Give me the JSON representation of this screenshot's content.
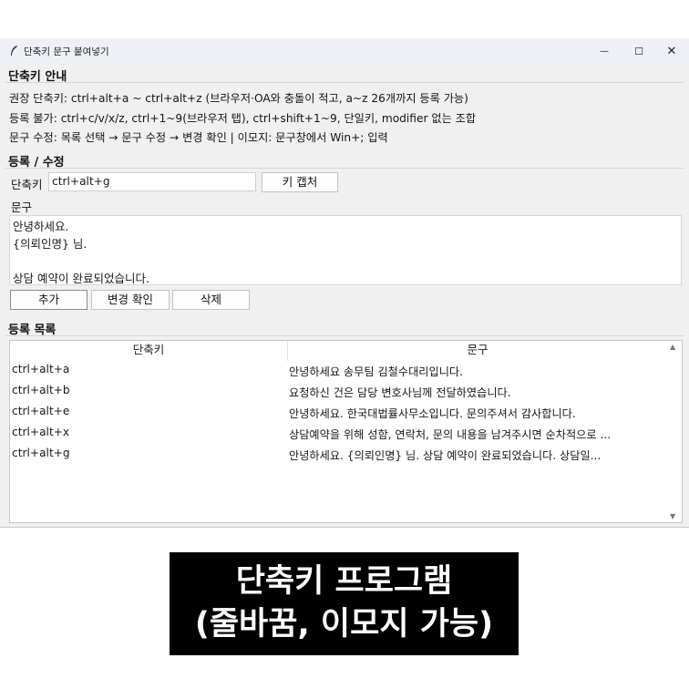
{
  "window": {
    "title": "단축키 문구 붙여넣기",
    "controls": {
      "minimize": "—",
      "maximize": "☐",
      "close": "✕"
    }
  },
  "guide": {
    "header": "단축키 안내",
    "lines": [
      "권장 단축키: ctrl+alt+a ~ ctrl+alt+z  (브라우저·OA와 충돌이 적고, a~z 26개까지 등록 가능)",
      "등록 불가: ctrl+c/v/x/z, ctrl+1~9(브라우저 탭), ctrl+shift+1~9, 단일키, modifier 없는 조합",
      "문구 수정: 목록 선택 → 문구 수정 → 변경 확인  |  이모지: 문구창에서 Win+; 입력"
    ]
  },
  "edit": {
    "header": "등록 / 수정",
    "hotkey_label": "단축키",
    "hotkey_value": "ctrl+alt+g",
    "capture_button": "키 캡처",
    "phrase_label": "문구",
    "phrase_lines": [
      "안녕하세요.",
      "{의뢰인명} 님.",
      "",
      "상담 예약이 완료되었습니다."
    ],
    "buttons": {
      "add": "추가",
      "confirm": "변경 확인",
      "delete": "삭제"
    }
  },
  "list": {
    "header": "등록 목록",
    "columns": [
      "단축키",
      "문구"
    ],
    "rows": [
      {
        "hotkey": "ctrl+alt+a",
        "phrase": "안녕하세요 송무팀 김철수대리입니다."
      },
      {
        "hotkey": "ctrl+alt+b",
        "phrase": "요청하신 건은 담당 변호사님께 전달하였습니다."
      },
      {
        "hotkey": "ctrl+alt+e",
        "phrase": "안녕하세요. 한국대법률사무소입니다. 문의주셔서 감사합니다."
      },
      {
        "hotkey": "ctrl+alt+x",
        "phrase": "상담예약을 위해 성함, 연락처, 문의 내용을 남겨주시면 순차적으로 ..."
      },
      {
        "hotkey": "ctrl+alt+g",
        "phrase": "안녕하세요. {의뢰인명} 님.  상담 예약이 완료되었습니다. 상담일..."
      }
    ]
  },
  "caption": {
    "line1": "단축키 프로그램",
    "line2": "(줄바꿈, 이모지 가능)"
  }
}
